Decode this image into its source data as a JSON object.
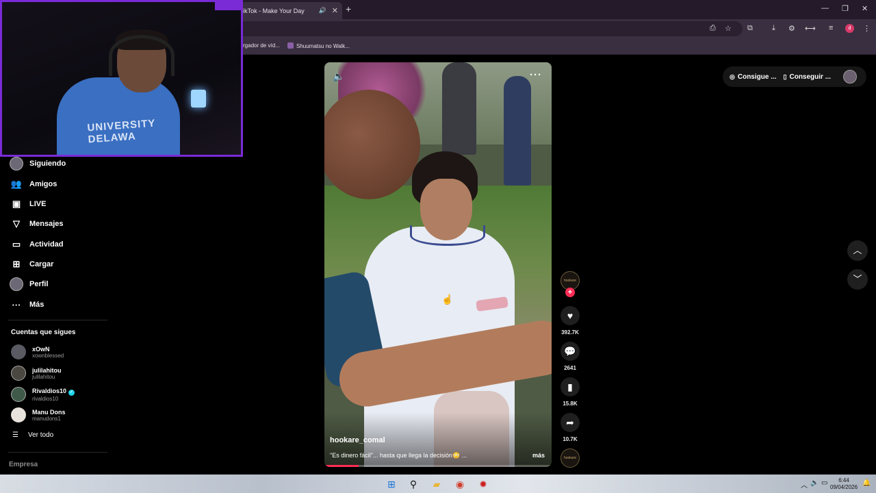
{
  "browser": {
    "tab_title": "TikTok - Make Your Day",
    "bookmarks": [
      "rgador de víd...",
      "Shuumatsu no Walk..."
    ]
  },
  "sidebar": {
    "items": [
      {
        "label": "Siguiendo",
        "icon": "following-avatar-icon"
      },
      {
        "label": "Amigos",
        "icon": "friends-icon"
      },
      {
        "label": "LIVE",
        "icon": "live-icon"
      },
      {
        "label": "Mensajes",
        "icon": "messages-icon"
      },
      {
        "label": "Actividad",
        "icon": "activity-icon"
      },
      {
        "label": "Cargar",
        "icon": "upload-icon"
      },
      {
        "label": "Perfil",
        "icon": "profile-avatar-icon"
      },
      {
        "label": "Más",
        "icon": "more-icon"
      }
    ],
    "following_title": "Cuentas que sigues",
    "following": [
      {
        "name": "xOwN",
        "handle": "xownblessed",
        "verified": false
      },
      {
        "name": "julilahitou",
        "handle": "julilahitou",
        "verified": false
      },
      {
        "name": "Rivaldios10",
        "handle": "rivaldios10",
        "verified": true
      },
      {
        "name": "Manu Dons",
        "handle": "manudons1",
        "verified": false
      }
    ],
    "see_all": "Ver todo",
    "footer": "Empresa"
  },
  "video": {
    "username": "hookare_comal",
    "caption": "\"Es dinero fácil\"... hasta que llega la decisión😳 ...",
    "more": "más",
    "progress": 0.15
  },
  "actions": {
    "likes": "392.7K",
    "comments": "2641",
    "saves": "15.8K",
    "shares": "10.7K"
  },
  "topbar": {
    "coins_label": "Consigue ...",
    "app_label": "Conseguir ..."
  },
  "taskbar": {
    "time": "6:44",
    "date": "09/04/2026"
  }
}
